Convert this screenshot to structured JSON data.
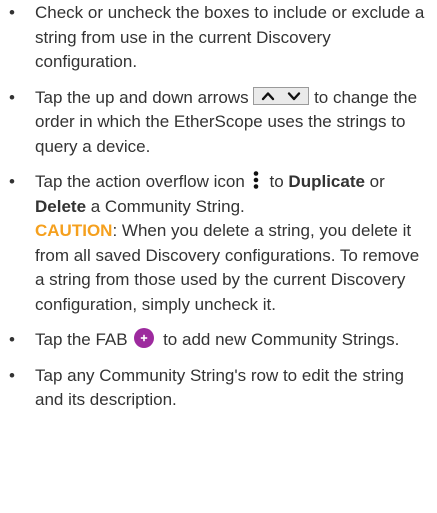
{
  "items": [
    {
      "text": "Check or uncheck the boxes to include or exclude a string from use in the current Discovery configuration."
    },
    {
      "before": "Tap the up and down arrows",
      "after": "to change the order in which the EtherScope uses the strings to query a device.",
      "icon": "up-down-arrows-icon"
    },
    {
      "before": "Tap the action overflow icon",
      "mid1": " to ",
      "bold1": "Duplicate",
      "mid2": " or ",
      "bold2": "Delete",
      "after": " a Community String.",
      "icon": "overflow-menu-icon",
      "caution_label": "CAUTION",
      "caution_text": ": When you delete a string, you delete it from all saved Discovery configurations. To remove a string from those used by the current Discovery configuration, simply uncheck it."
    },
    {
      "before": "Tap the FAB",
      "after": " to add new Community Strings.",
      "icon": "fab-plus-icon"
    },
    {
      "text": "Tap any Community String's row to edit the string and its description."
    }
  ],
  "bullet_char": "•",
  "colors": {
    "text": "#333333",
    "caution": "#f5a01e",
    "fab": "#9d2a9e"
  }
}
